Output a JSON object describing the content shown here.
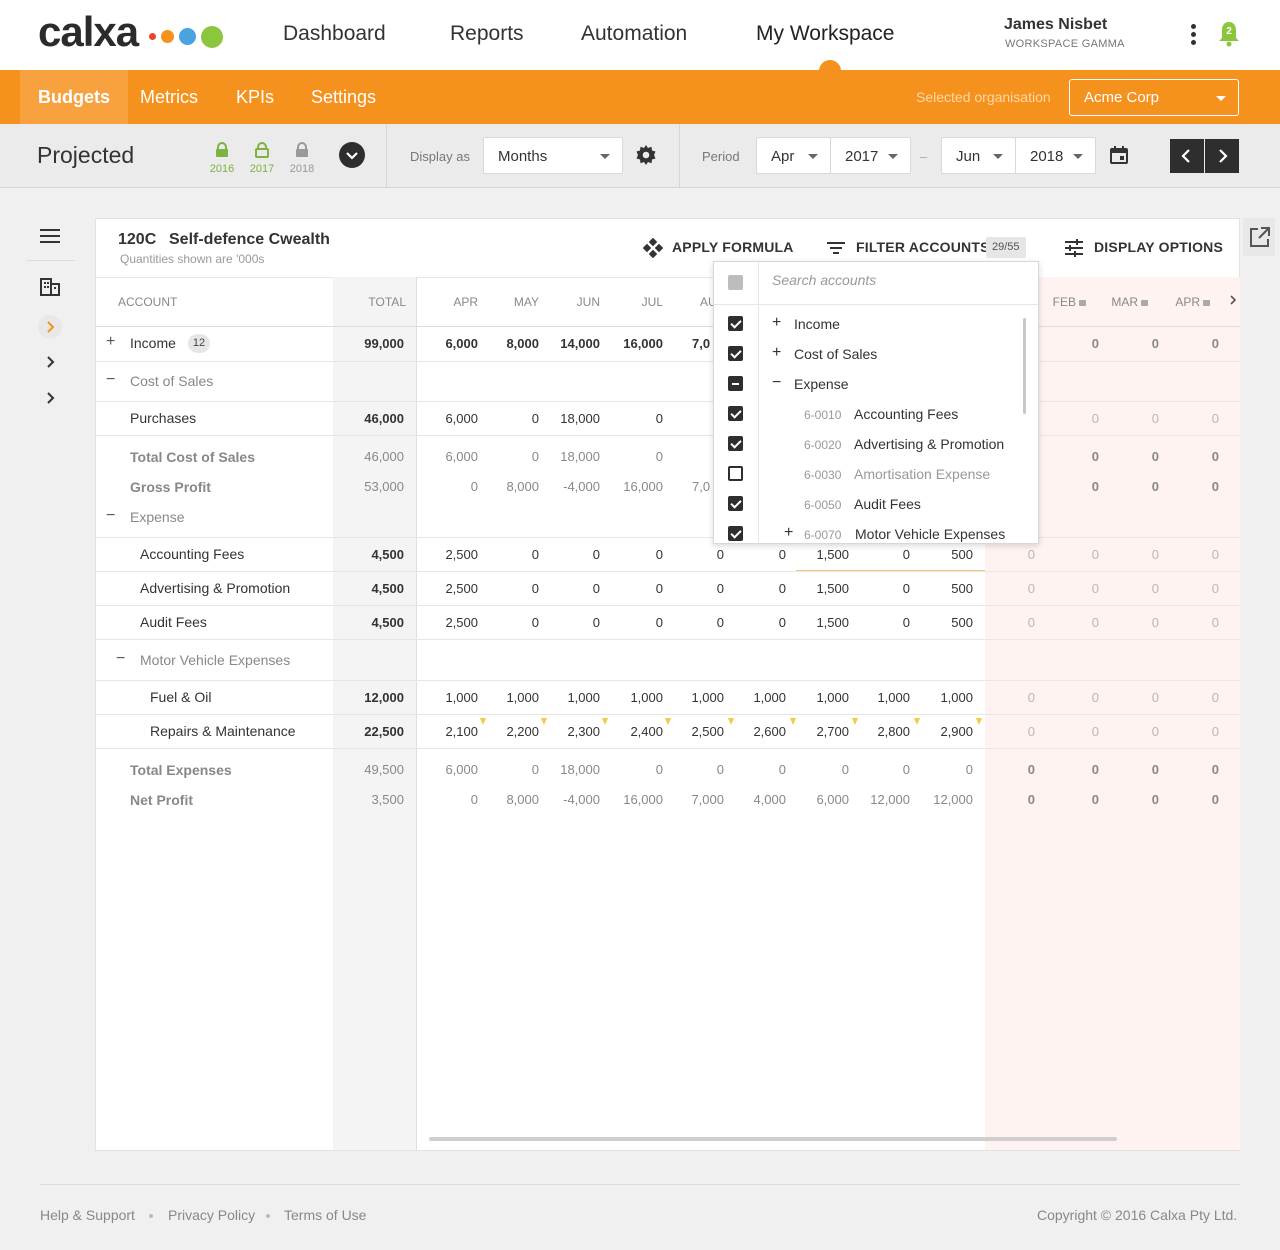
{
  "brand": {
    "logo": "calxa",
    "dot_colors": [
      "#e8452c",
      "#f5921e",
      "#4aa3df",
      "#8cc63f"
    ]
  },
  "nav": {
    "items": [
      "Dashboard",
      "Reports",
      "Automation",
      "My Workspace"
    ],
    "active": "My Workspace",
    "user_name": "James Nisbet",
    "workspace": "WORKSPACE GAMMA",
    "notification_count": "2"
  },
  "subnav": {
    "tabs": [
      "Budgets",
      "Metrics",
      "KPIs",
      "Settings"
    ],
    "active": "Budgets",
    "org_label": "Selected organisation",
    "org_value": "Acme Corp"
  },
  "toolbar": {
    "title": "Projected",
    "years": [
      {
        "year": "2016",
        "locked": true
      },
      {
        "year": "2017",
        "locked": false
      },
      {
        "year": "2018",
        "locked": true
      }
    ],
    "display_as_label": "Display as",
    "display_as_value": "Months",
    "period_label": "Period",
    "from_month": "Apr",
    "from_year": "2017",
    "range_sep": "–",
    "to_month": "Jun",
    "to_year": "2018"
  },
  "panel": {
    "account_code": "120C",
    "account_name": "Self-defence Cwealth",
    "note": "Quantities shown are '000s",
    "apply_formula": "APPLY FORMULA",
    "filter_accounts": "FILTER ACCOUNTS",
    "filter_count": "29/55",
    "display_options": "DISPLAY OPTIONS"
  },
  "table": {
    "headers": {
      "account": "ACCOUNT",
      "total": "TOTAL",
      "months": [
        "APR",
        "MAY",
        "JUN",
        "JUL",
        "AU"
      ],
      "right_months": [
        "FEB",
        "MAR",
        "APR"
      ]
    },
    "income_count": "12",
    "rows": [
      {
        "label": "Income",
        "total": "99,000",
        "vals": [
          "6,000",
          "8,000",
          "14,000",
          "16,000",
          "7,0"
        ],
        "right": [
          "0",
          "0",
          "0"
        ]
      },
      {
        "label": "Cost of Sales"
      },
      {
        "label": "Purchases",
        "total": "46,000",
        "vals": [
          "6,000",
          "0",
          "18,000",
          "0"
        ],
        "right": [
          "0",
          "0",
          "0"
        ]
      },
      {
        "label": "Total Cost of Sales",
        "total": "46,000",
        "vals": [
          "6,000",
          "0",
          "18,000",
          "0"
        ],
        "right": [
          "0",
          "0",
          "0"
        ]
      },
      {
        "label": "Gross Profit",
        "total": "53,000",
        "vals": [
          "0",
          "8,000",
          "-4,000",
          "16,000",
          "7,0"
        ],
        "right": [
          "0",
          "0",
          "0"
        ]
      },
      {
        "label": "Expense"
      },
      {
        "label": "Accounting Fees",
        "total": "4,500",
        "vals": [
          "2,500",
          "0",
          "0",
          "0",
          "0",
          "0",
          "1,500",
          "0",
          "500",
          "0"
        ],
        "right": [
          "0",
          "0",
          "0"
        ]
      },
      {
        "label": "Advertising & Promotion",
        "total": "4,500",
        "vals": [
          "2,500",
          "0",
          "0",
          "0",
          "0",
          "0",
          "1,500",
          "0",
          "500",
          "0"
        ],
        "right": [
          "0",
          "0",
          "0"
        ]
      },
      {
        "label": "Audit Fees",
        "total": "4,500",
        "vals": [
          "2,500",
          "0",
          "0",
          "0",
          "0",
          "0",
          "1,500",
          "0",
          "500",
          "0"
        ],
        "right": [
          "0",
          "0",
          "0"
        ]
      },
      {
        "label": "Motor Vehicle Expenses"
      },
      {
        "label": "Fuel & Oil",
        "total": "12,000",
        "vals": [
          "1,000",
          "1,000",
          "1,000",
          "1,000",
          "1,000",
          "1,000",
          "1,000",
          "1,000",
          "1,000",
          "0"
        ],
        "right": [
          "0",
          "0",
          "0"
        ]
      },
      {
        "label": "Repairs & Maintenance",
        "total": "22,500",
        "vals": [
          "2,100",
          "2,200",
          "2,300",
          "2,400",
          "2,500",
          "2,600",
          "2,700",
          "2,800",
          "2,900",
          "0"
        ],
        "right": [
          "0",
          "0",
          "0"
        ]
      },
      {
        "label": "Total Expenses",
        "total": "49,500",
        "vals": [
          "6,000",
          "0",
          "18,000",
          "0",
          "0",
          "0",
          "0",
          "0",
          "0",
          "0"
        ],
        "right": [
          "0",
          "0",
          "0"
        ]
      },
      {
        "label": "Net Profit",
        "total": "3,500",
        "vals": [
          "0",
          "8,000",
          "-4,000",
          "16,000",
          "7,000",
          "4,000",
          "6,000",
          "12,000",
          "12,000",
          "0"
        ],
        "right": [
          "0",
          "0",
          "0"
        ]
      }
    ]
  },
  "filter_dropdown": {
    "search_placeholder": "Search accounts",
    "items": [
      {
        "code": "",
        "label": "Income",
        "state": "checked"
      },
      {
        "code": "",
        "label": "Cost of Sales",
        "state": "checked"
      },
      {
        "code": "",
        "label": "Expense",
        "state": "indeterminate"
      },
      {
        "code": "6-0010",
        "label": "Accounting Fees",
        "state": "checked"
      },
      {
        "code": "6-0020",
        "label": "Advertising & Promotion",
        "state": "checked"
      },
      {
        "code": "6-0030",
        "label": "Amortisation Expense",
        "state": "unchecked"
      },
      {
        "code": "6-0050",
        "label": "Audit Fees",
        "state": "checked"
      },
      {
        "code": "6-0070",
        "label": "Motor Vehicle Expenses",
        "state": "checked"
      }
    ]
  },
  "footer": {
    "links": [
      "Help & Support",
      "Privacy Policy",
      "Terms of Use"
    ],
    "copyright": "Copyright © 2016 Calxa Pty Ltd."
  }
}
